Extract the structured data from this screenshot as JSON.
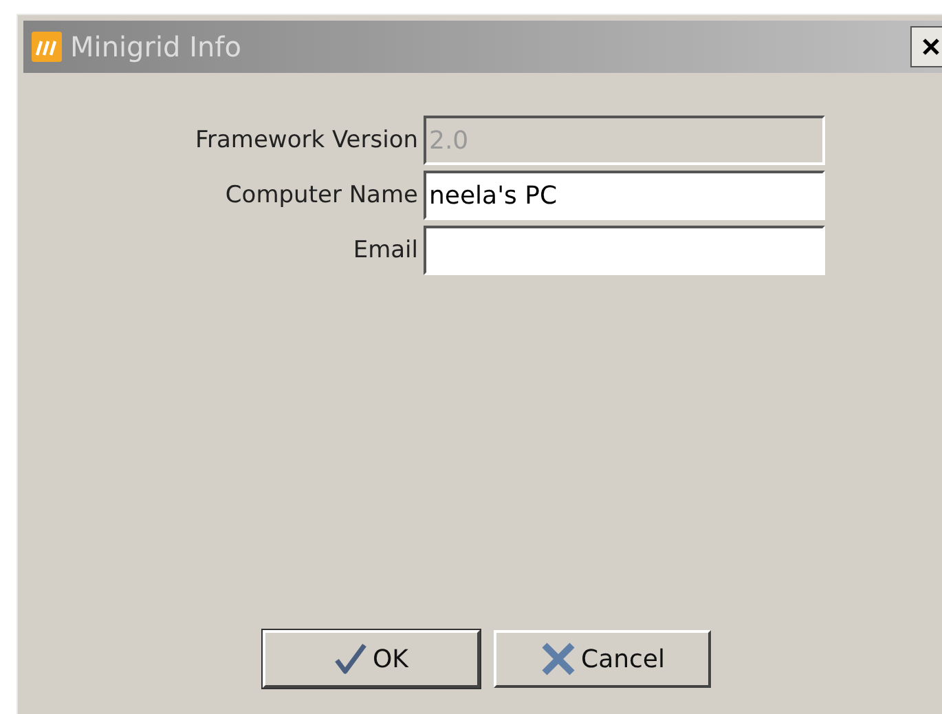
{
  "window": {
    "title": "Minigrid Info"
  },
  "fields": [
    {
      "label": "Framework Version",
      "value": "2.0",
      "disabled": true
    },
    {
      "label": "Computer Name",
      "value": "neela's PC",
      "disabled": false
    },
    {
      "label": "Email",
      "disabled": false
    }
  ],
  "buttons": [
    {
      "label": "OK",
      "kind": "ok"
    },
    {
      "label": "Cancel",
      "kind": "cancel"
    }
  ]
}
